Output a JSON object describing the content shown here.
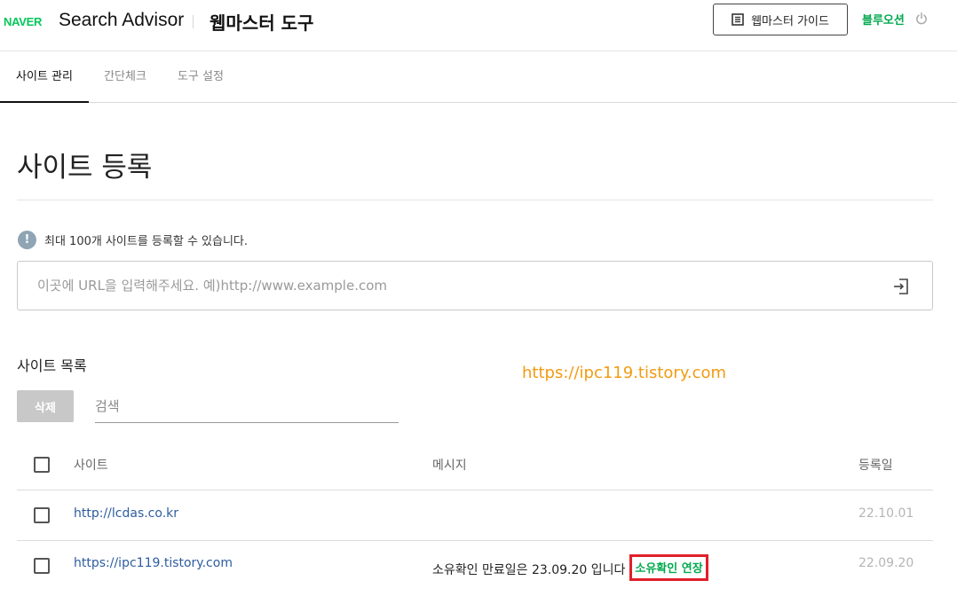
{
  "header": {
    "logo": "NAVER",
    "product": "Search Advisor",
    "tool_title": "웹마스터 도구",
    "guide_button": "웹마스터 가이드",
    "user_name": "블루오션"
  },
  "tabs": [
    {
      "label": "사이트 관리",
      "active": true
    },
    {
      "label": "간단체크",
      "active": false
    },
    {
      "label": "도구 설정",
      "active": false
    }
  ],
  "page": {
    "title": "사이트 등록",
    "notice": "최대 100개 사이트를 등록할 수 있습니다.",
    "url_placeholder": "이곳에 URL을 입력해주세요. 예)http://www.example.com"
  },
  "site_list": {
    "title": "사이트 목록",
    "delete_label": "삭제",
    "search_placeholder": "검색",
    "columns": {
      "site": "사이트",
      "message": "메시지",
      "date": "등록일"
    },
    "rows": [
      {
        "site": "http://lcdas.co.kr",
        "message": "",
        "action": "",
        "date": "22.10.01"
      },
      {
        "site": "https://ipc119.tistory.com",
        "message": "소유확인 만료일은 23.09.20 입니다",
        "action": "소유확인 연장",
        "date": "22.09.20"
      }
    ]
  },
  "watermark": "https://ipc119.tistory.com",
  "colors": {
    "brand_green": "#03c75a",
    "link_blue": "#2e5d9f",
    "highlight_red": "#e0202a",
    "watermark_orange": "#f29b12"
  },
  "icons": {
    "guide": "book-icon",
    "logout": "power-icon",
    "notice": "info-icon",
    "submit": "enter-icon"
  }
}
